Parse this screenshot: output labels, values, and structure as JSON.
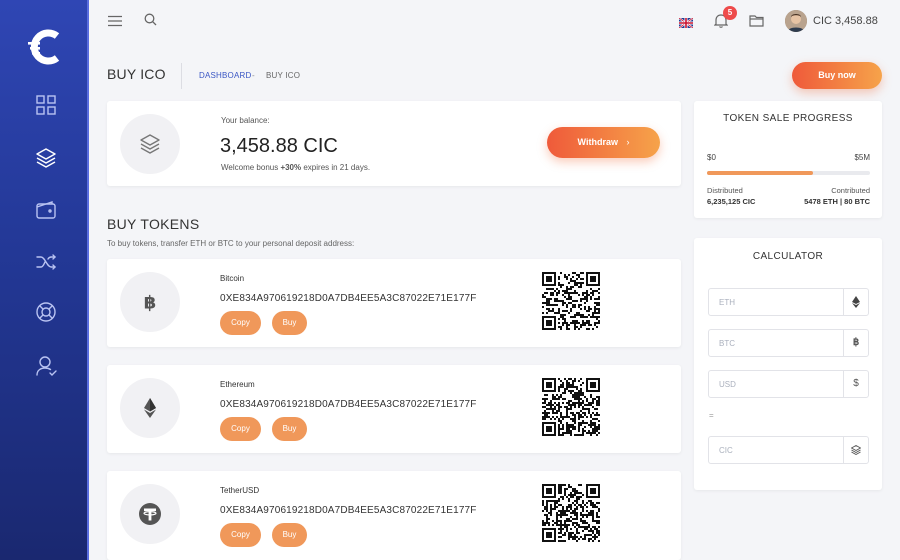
{
  "sidebar": {
    "logo": "cic-logo",
    "items": [
      {
        "name": "dashboard",
        "icon": "grid-icon"
      },
      {
        "name": "tokens",
        "icon": "layers-icon"
      },
      {
        "name": "wallet",
        "icon": "wallet-icon"
      },
      {
        "name": "transactions",
        "icon": "shuffle-icon"
      },
      {
        "name": "support",
        "icon": "lifebuoy-icon"
      },
      {
        "name": "profile",
        "icon": "user-icon"
      }
    ],
    "colors": {
      "top": "#2f46b4",
      "bottom": "#1a2870"
    }
  },
  "topbar": {
    "notification_count": "5",
    "user_balance": "CIC 3,458.88",
    "language": "en-gb"
  },
  "header": {
    "title": "BUY ICO",
    "breadcrumb_root": "DASHBOARD",
    "breadcrumb_sep": " - ",
    "breadcrumb_current": "BUY ICO",
    "buy_now_label": "Buy now"
  },
  "balance": {
    "label": "Your balance:",
    "amount": "3,458.88 CIC",
    "bonus_prefix": "Welcome bonus ",
    "bonus_value": "+30%",
    "bonus_suffix": " expires in 21 days.",
    "withdraw_label": "Withdraw",
    "withdraw_arrow": "›"
  },
  "buy_tokens": {
    "title": "BUY TOKENS",
    "subtitle": "To buy tokens, transfer ETH or BTC to your personal deposit address:",
    "copy_label": "Copy",
    "buy_label": "Buy",
    "coins": [
      {
        "name": "Bitcoin",
        "address": "0XE834A970619218D0A7DB4EE5A3C87022E71E177F",
        "icon": "bitcoin-icon"
      },
      {
        "name": "Ethereum",
        "address": "0XE834A970619218D0A7DB4EE5A3C87022E71E177F",
        "icon": "ethereum-icon"
      },
      {
        "name": "TetherUSD",
        "address": "0XE834A970619218D0A7DB4EE5A3C87022E71E177F",
        "icon": "tether-icon"
      }
    ]
  },
  "progress": {
    "title": "TOKEN SALE PROGRESS",
    "min": "$0",
    "max": "$5M",
    "fill_fraction": 0.65,
    "distributed_label": "Distributed",
    "distributed_value": "6,235,125 CIC",
    "contributed_label": "Contributed",
    "contributed_value": "5478 ETH | 80 BTC",
    "bar_color": "#f0985a"
  },
  "calculator": {
    "title": "CALCULATOR",
    "eth_placeholder": "ETH",
    "btc_placeholder": "BTC",
    "btc_symbol": "฿",
    "usd_placeholder": "USD",
    "usd_symbol": "$",
    "equals": "=",
    "cic_placeholder": "CIC"
  },
  "colors": {
    "accent_start": "#ef5a3a",
    "accent_end": "#f6a34a",
    "link": "#3a56c4"
  }
}
